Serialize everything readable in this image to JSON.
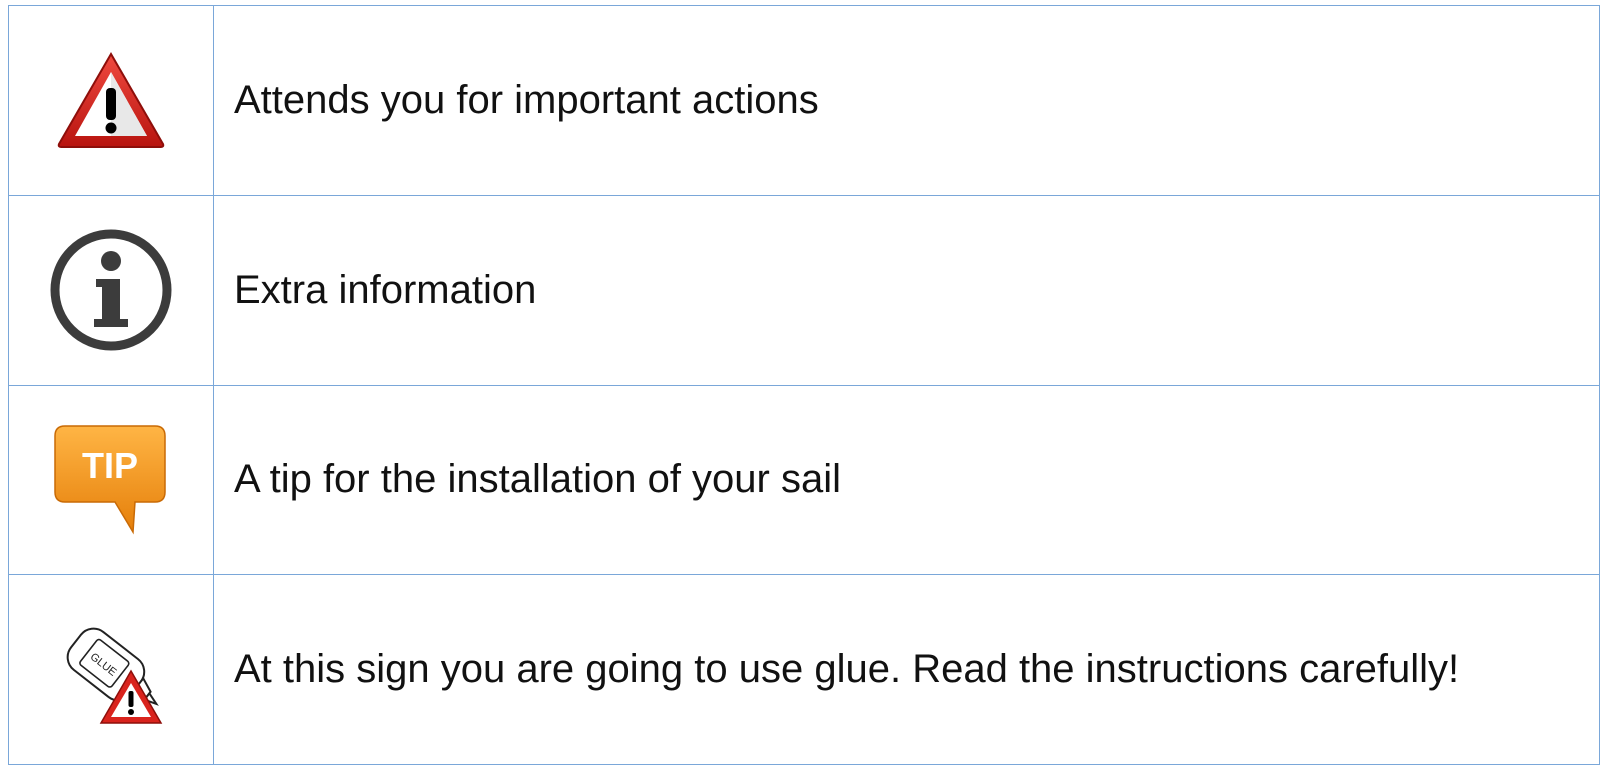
{
  "legend": {
    "rows": [
      {
        "icon": "warning-triangle-icon",
        "text": "Attends you for important actions"
      },
      {
        "icon": "info-circle-icon",
        "text": "Extra information"
      },
      {
        "icon": "tip-bubble-icon",
        "icon_label": "TIP",
        "text": "A tip for the installation of your sail"
      },
      {
        "icon": "glue-bottle-warning-icon",
        "icon_label": "GLUE",
        "text": "At this sign you are going to use glue. Read the instructions carefully!"
      }
    ]
  },
  "colors": {
    "border": "#7aa7d9",
    "warning_red": "#d9231d",
    "info_gray": "#3c3c3c",
    "tip_orange": "#f39a1c"
  }
}
